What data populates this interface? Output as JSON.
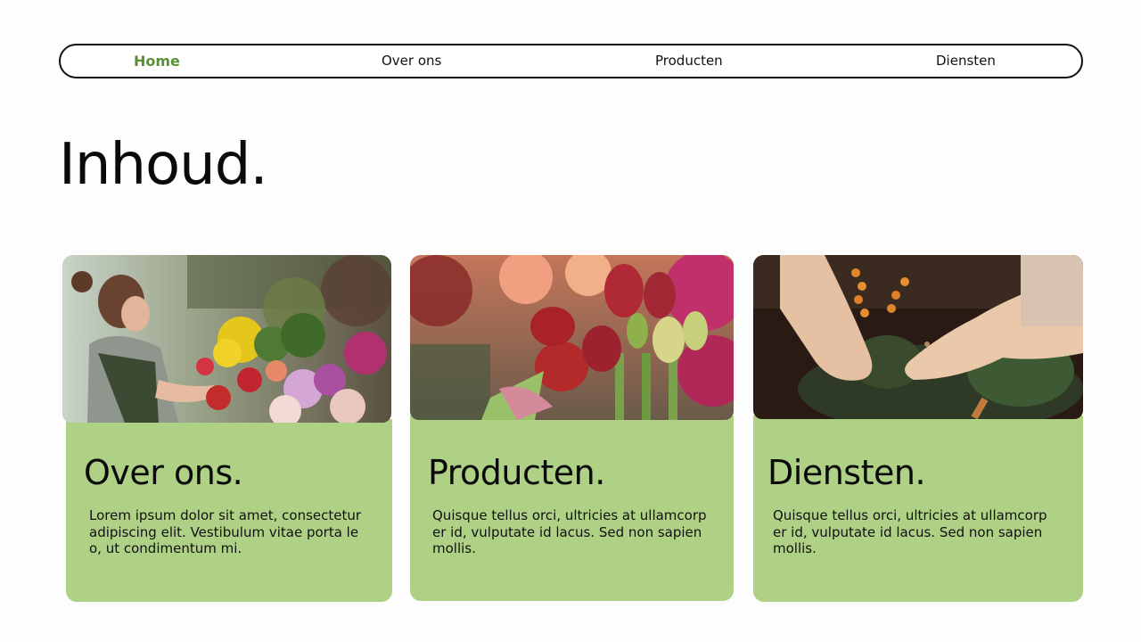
{
  "nav": {
    "items": [
      {
        "label": "Home",
        "active": true
      },
      {
        "label": "Over ons",
        "active": false
      },
      {
        "label": "Producten",
        "active": false
      },
      {
        "label": "Diensten",
        "active": false
      }
    ]
  },
  "page": {
    "title": "Inhoud."
  },
  "cards": [
    {
      "title": "Over ons.",
      "text": "Lorem ipsum dolor sit amet, consectetur adipiscing elit. Vestibulum vitae porta le o, ut condimentum mi.",
      "image": "florist-arranging-flowers-photo"
    },
    {
      "title": "Producten.",
      "text": "Quisque tellus orci, ultricies at ullamcorp er id, vulputate id lacus. Sed non sapien mollis.",
      "image": "tulip-bouquet-photo"
    },
    {
      "title": "Diensten.",
      "text": "Quisque tellus orci, ultricies at ullamcorp er id, vulputate id lacus. Sed non sapien mollis.",
      "image": "hands-making-wreath-photo"
    }
  ],
  "colors": {
    "accent_green": "#5a8f34",
    "card_green": "#afd186",
    "background": "#fdfdfd",
    "text": "#111111"
  }
}
